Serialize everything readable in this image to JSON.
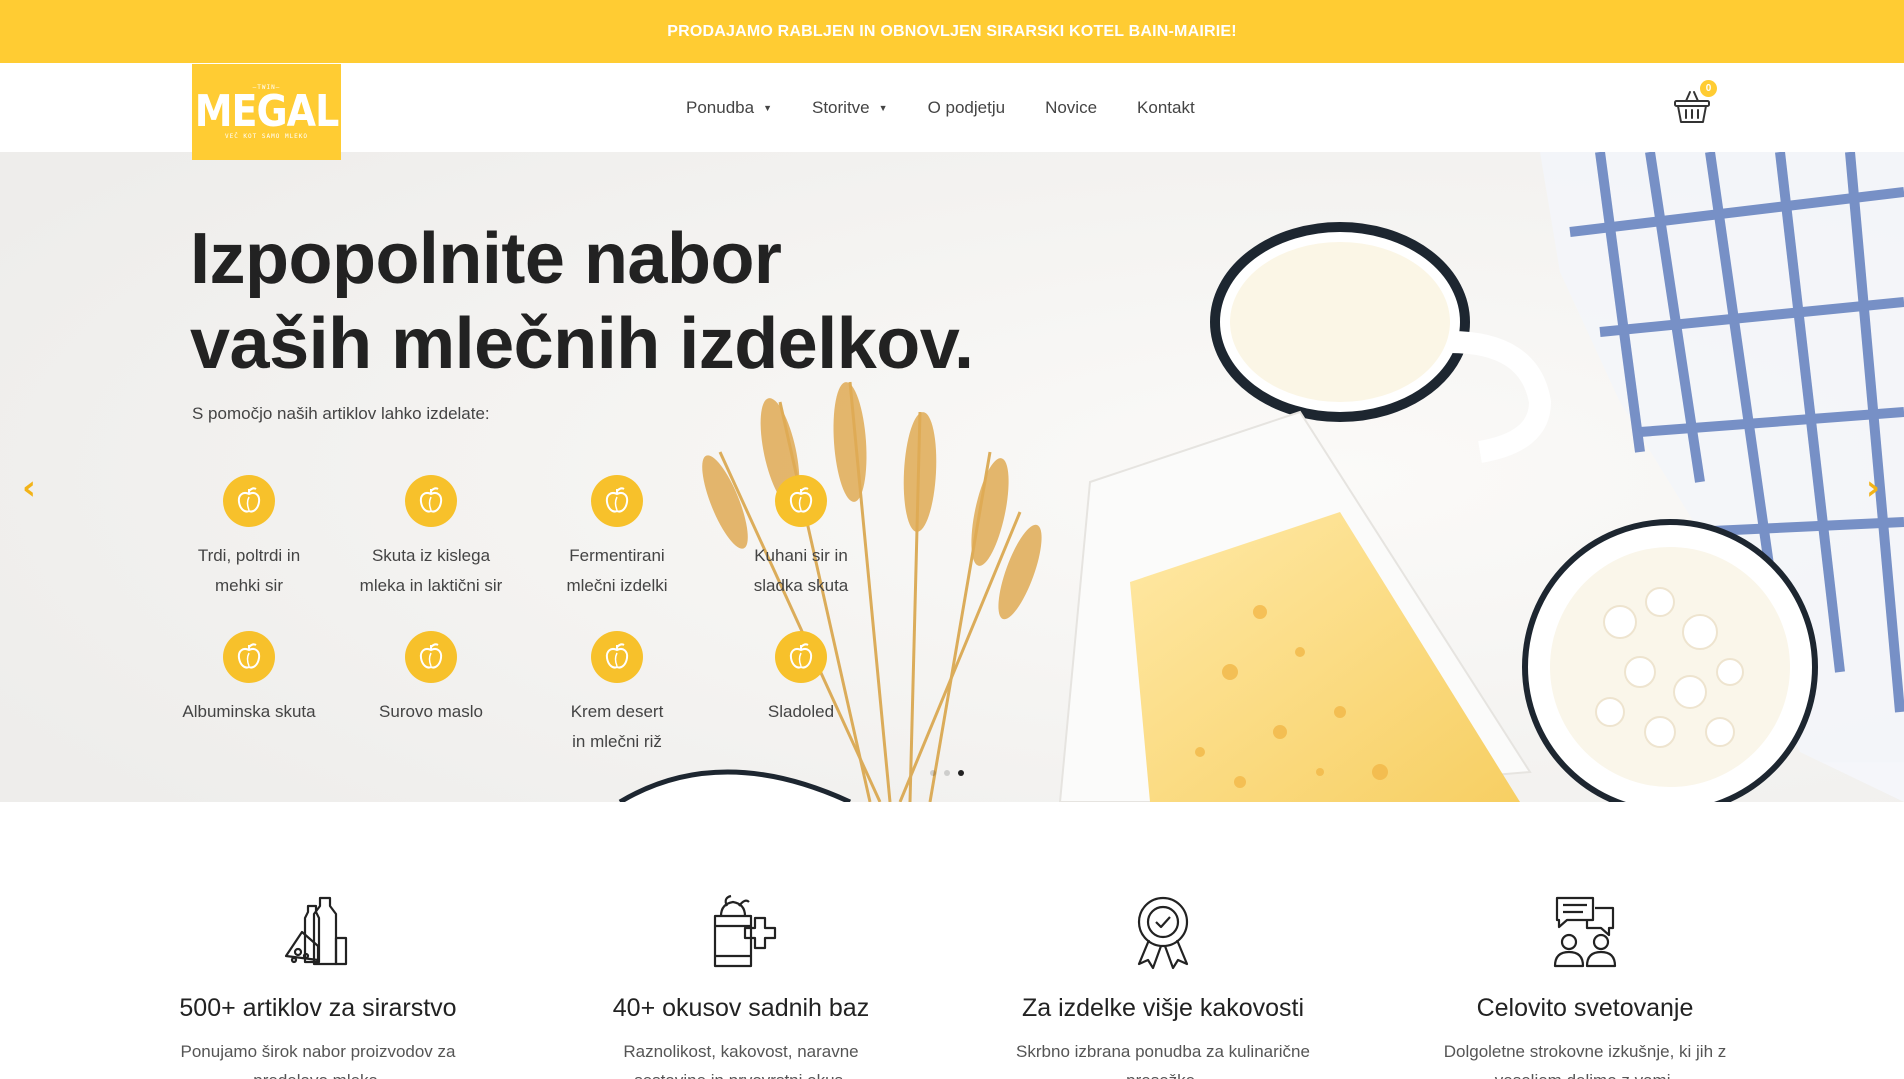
{
  "promo": {
    "text": "PRODAJAMO RABLJEN IN OBNOVLJEN SIRARSKI KOTEL BAIN-MAIRIE!"
  },
  "logo": {
    "top_text": "—TWIN—",
    "name": "MEGAL",
    "tagline": "VEČ KOT SAMO MLEKO"
  },
  "nav": {
    "items": [
      {
        "label": "Ponudba",
        "dropdown": true
      },
      {
        "label": "Storitve",
        "dropdown": true
      },
      {
        "label": "O podjetju",
        "dropdown": false
      },
      {
        "label": "Novice",
        "dropdown": false
      },
      {
        "label": "Kontakt",
        "dropdown": false
      }
    ],
    "caret": "▼"
  },
  "cart": {
    "count": "0",
    "icon": "basket-icon"
  },
  "hero": {
    "title_line1": "Izpopolnite nabor",
    "title_line2": "vaših mlečnih izdelkov.",
    "subtitle": "S pomočjo naših artiklov lahko izdelate:",
    "features": [
      {
        "line1": "Trdi, poltrdi in",
        "line2": "mehki sir"
      },
      {
        "line1": "Skuta iz kislega",
        "line2": "mleka in laktični sir"
      },
      {
        "line1": "Fermentirani",
        "line2": "mlečni izdelki"
      },
      {
        "line1": "Kuhani sir in",
        "line2": "sladka skuta"
      },
      {
        "line1": "Albuminska skuta",
        "line2": ""
      },
      {
        "line1": "Surovo maslo",
        "line2": ""
      },
      {
        "line1": "Krem desert",
        "line2": "in mlečni riž"
      },
      {
        "line1": "Sladoled",
        "line2": ""
      }
    ],
    "feature_icon": "fruit-icon",
    "prev_arrow": "‹",
    "next_arrow": "›",
    "slides": 3,
    "active_slide": 3
  },
  "services": [
    {
      "icon": "dairy-products-icon",
      "title": "500+ artiklov za sirarstvo",
      "line1": "Ponujamo širok nabor proizvodov za",
      "line2": "predelavo mleka."
    },
    {
      "icon": "fruit-base-icon",
      "title": "40+ okusov sadnih baz",
      "line1": "Raznolikost, kakovost, naravne",
      "line2": "sestavine in prvovrstni okus."
    },
    {
      "icon": "quality-badge-icon",
      "title": "Za izdelke višje kakovosti",
      "line1": "Skrbno izbrana ponudba za kulinarične",
      "line2": "presežke."
    },
    {
      "icon": "consulting-icon",
      "title": "Celovito svetovanje",
      "line1": "Dolgoletne strokovne izkušnje, ki jih z",
      "line2": "veseljem delimo z vami."
    }
  ],
  "colors": {
    "accent": "#ffcc33",
    "icon_yellow": "#f7c12b",
    "arrow": "#f2b318",
    "text_dark": "#222222"
  }
}
